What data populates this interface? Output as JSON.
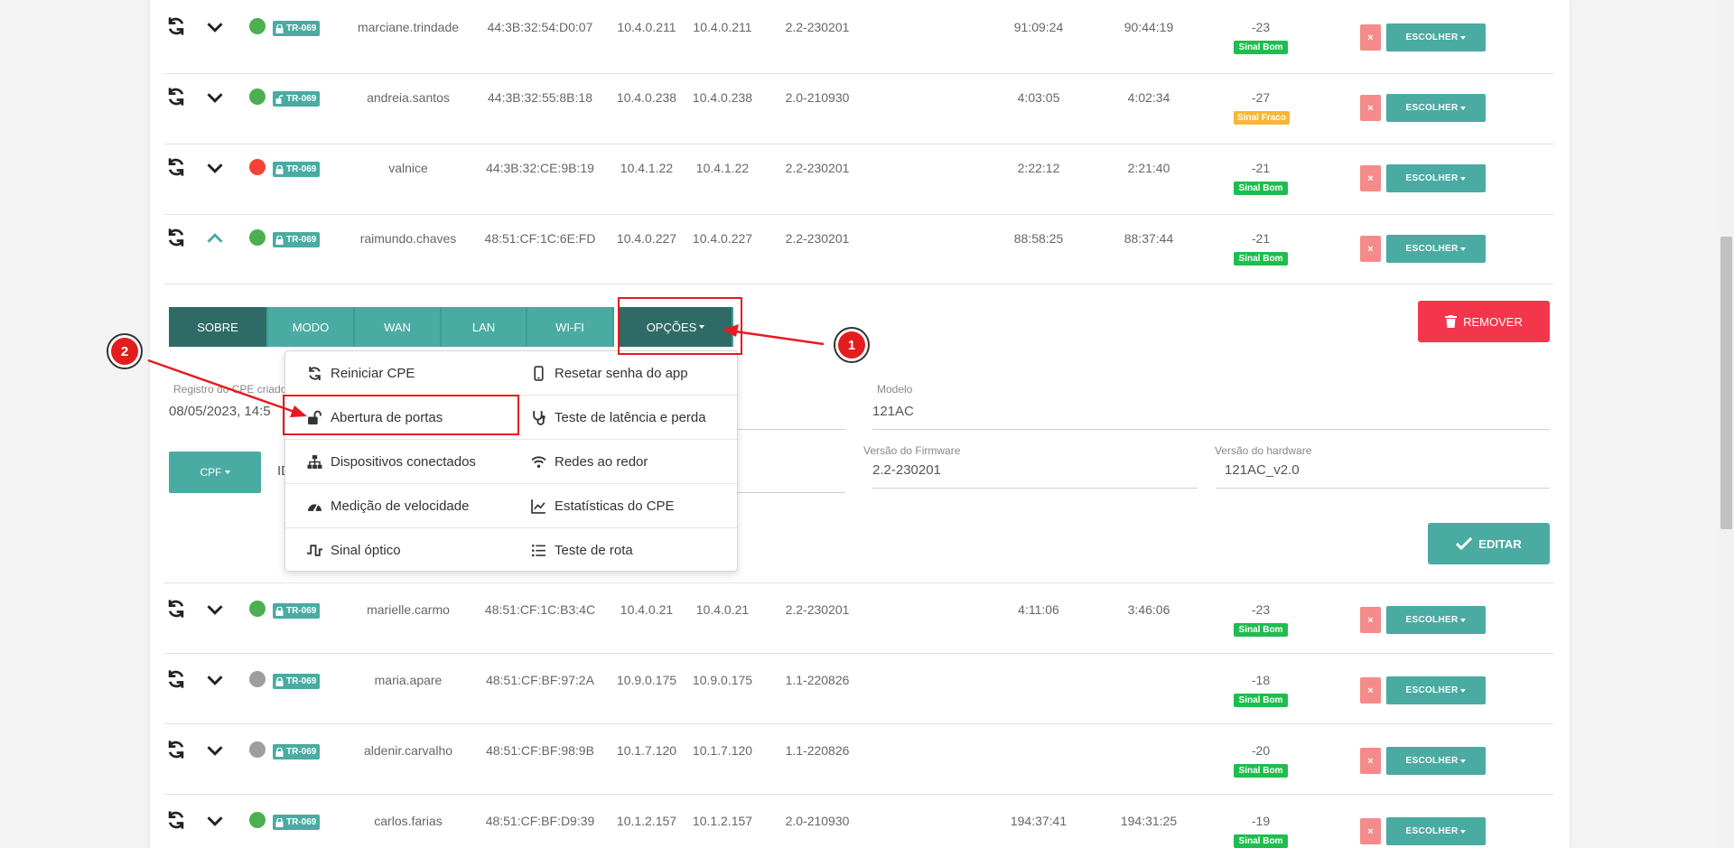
{
  "colors": {
    "accent": "#4aaba2",
    "accent_dark": "#2f6b66",
    "online": "#4caf50",
    "offline": "#f44336",
    "unknown": "#9e9e9e",
    "danger": "#f4364c",
    "annotation": "#e8191f"
  },
  "rows_top": [
    {
      "status": "online",
      "locked": true,
      "badge": "TR-069",
      "user": "marciane.trindade",
      "mac": "44:3B:32:54:D0:07",
      "ip1": "10.4.0.211",
      "ip2": "10.4.0.211",
      "fw": "2.2-230201",
      "t1": "91:09:24",
      "t2": "90:44:19",
      "rssi": "-23",
      "signal": "Sinal Bom",
      "signal_type": "good",
      "choose": "ESCOLHER",
      "x": "×"
    },
    {
      "status": "online",
      "locked": false,
      "badge": "TR-069",
      "user": "andreia.santos",
      "mac": "44:3B:32:55:8B:18",
      "ip1": "10.4.0.238",
      "ip2": "10.4.0.238",
      "fw": "2.0-210930",
      "t1": "4:03:05",
      "t2": "4:02:34",
      "rssi": "-27",
      "signal": "Sinal Fraco",
      "signal_type": "weak",
      "choose": "ESCOLHER",
      "x": "×"
    },
    {
      "status": "offline",
      "locked": true,
      "badge": "TR-069",
      "user": "valnice",
      "mac": "44:3B:32:CE:9B:19",
      "ip1": "10.4.1.22",
      "ip2": "10.4.1.22",
      "fw": "2.2-230201",
      "t1": "2:22:12",
      "t2": "2:21:40",
      "rssi": "-21",
      "signal": "Sinal Bom",
      "signal_type": "good",
      "choose": "ESCOLHER",
      "x": "×"
    },
    {
      "status": "online",
      "locked": true,
      "badge": "TR-069",
      "user": "raimundo.chaves",
      "mac": "48:51:CF:1C:6E:FD",
      "ip1": "10.4.0.227",
      "ip2": "10.4.0.227",
      "fw": "2.2-230201",
      "t1": "88:58:25",
      "t2": "88:37:44",
      "rssi": "-21",
      "signal": "Sinal Bom",
      "signal_type": "good",
      "choose": "ESCOLHER",
      "x": "×",
      "expanded": true
    }
  ],
  "rows_bottom": [
    {
      "status": "online",
      "locked": true,
      "badge": "TR-069",
      "user": "marielle.carmo",
      "mac": "48:51:CF:1C:B3:4C",
      "ip1": "10.4.0.21",
      "ip2": "10.4.0.21",
      "fw": "2.2-230201",
      "t1": "4:11:06",
      "t2": "3:46:06",
      "rssi": "-23",
      "signal": "Sinal Bom",
      "signal_type": "good",
      "choose": "ESCOLHER",
      "x": "×"
    },
    {
      "status": "unknown",
      "locked": true,
      "badge": "TR-069",
      "user": "maria.apare",
      "mac": "48:51:CF:BF:97:2A",
      "ip1": "10.9.0.175",
      "ip2": "10.9.0.175",
      "fw": "1.1-220826",
      "t1": "",
      "t2": "",
      "rssi": "-18",
      "signal": "Sinal Bom",
      "signal_type": "good",
      "choose": "ESCOLHER",
      "x": "×"
    },
    {
      "status": "unknown",
      "locked": true,
      "badge": "TR-069",
      "user": "aldenir.carvalho",
      "mac": "48:51:CF:BF:98:9B",
      "ip1": "10.1.7.120",
      "ip2": "10.1.7.120",
      "fw": "1.1-220826",
      "t1": "",
      "t2": "",
      "rssi": "-20",
      "signal": "Sinal Bom",
      "signal_type": "good",
      "choose": "ESCOLHER",
      "x": "×"
    },
    {
      "status": "online",
      "locked": true,
      "badge": "TR-069",
      "user": "carlos.farias",
      "mac": "48:51:CF:BF:D9:39",
      "ip1": "10.1.2.157",
      "ip2": "10.1.2.157",
      "fw": "2.0-210930",
      "t1": "194:37:41",
      "t2": "194:31:25",
      "rssi": "-19",
      "signal": "Sinal Bom",
      "signal_type": "good",
      "choose": "ESCOLHER",
      "x": "×"
    }
  ],
  "tabs": {
    "sobre": "SOBRE",
    "modo": "MODO",
    "wan": "WAN",
    "lan": "LAN",
    "wifi": "WI-FI",
    "opcoes": "OPÇÕES"
  },
  "buttons": {
    "remove": "REMOVER",
    "edit": "EDITAR",
    "cpf": "CPF"
  },
  "fields": {
    "registro_label": "Registro do CPE criado",
    "registro_value": "08/05/2023, 14:5",
    "id_value": "ID",
    "modelo_label": "Modelo",
    "modelo_value": "121AC",
    "firmware_label": "Versão do Firmware",
    "firmware_value": "2.2-230201",
    "hardware_label": "Versão do hardware",
    "hardware_value": "121AC_v2.0"
  },
  "menu": {
    "reiniciar": "Reiniciar CPE",
    "resetar": "Resetar senha do app",
    "abertura": "Abertura de portas",
    "latencia": "Teste de latência e perda",
    "dispositivos": "Dispositivos conectados",
    "redes": "Redes ao redor",
    "medicao": "Medição de velocidade",
    "estatisticas": "Estatísticas do CPE",
    "sinal": "Sinal óptico",
    "rota": "Teste de rota"
  },
  "callouts": {
    "one": "1",
    "two": "2"
  }
}
